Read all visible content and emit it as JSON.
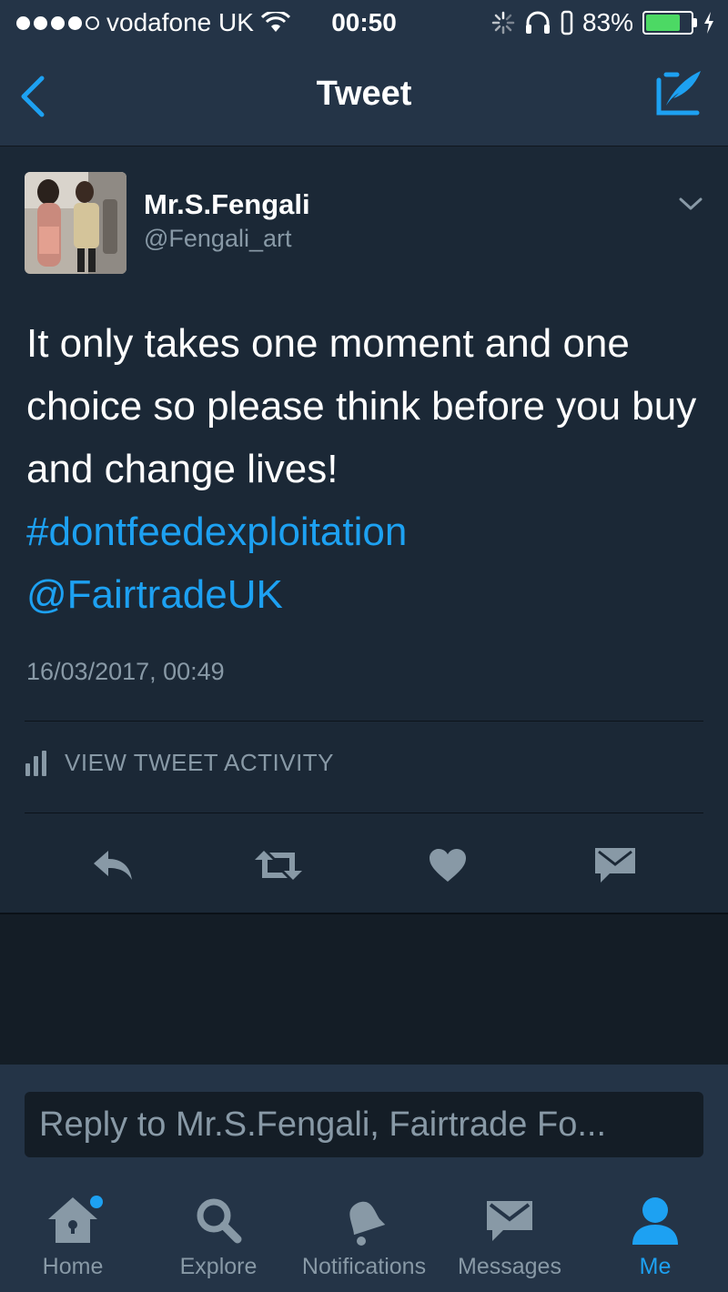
{
  "status_bar": {
    "carrier": "vodafone UK",
    "time": "00:50",
    "battery_percent": "83%",
    "battery_level": 0.83,
    "signal_bars_filled": 4,
    "signal_bars_total": 5
  },
  "nav": {
    "title": "Tweet",
    "back_icon": "chevron-left-icon",
    "compose_icon": "compose-tweet-icon"
  },
  "tweet": {
    "display_name": "Mr.S.Fengali",
    "handle": "@Fengali_art",
    "text_plain": "It only takes one moment and one choice so please think before you buy  and change lives!",
    "hashtag": "#dontfeedexploitation",
    "mention": "@FairtradeUK",
    "timestamp": "16/03/2017, 00:49",
    "activity_label": "VIEW TWEET ACTIVITY"
  },
  "actions": [
    "reply-icon",
    "retweet-icon",
    "like-icon",
    "direct-message-icon"
  ],
  "reply": {
    "placeholder": "Reply to Mr.S.Fengali, Fairtrade Fo..."
  },
  "tabs": [
    {
      "label": "Home",
      "icon": "home-icon",
      "badge": true
    },
    {
      "label": "Explore",
      "icon": "search-icon"
    },
    {
      "label": "Notifications",
      "icon": "bell-icon"
    },
    {
      "label": "Messages",
      "icon": "envelope-icon"
    },
    {
      "label": "Me",
      "icon": "person-icon",
      "active": true
    }
  ],
  "colors": {
    "accent": "#1da1f2",
    "background": "#141d26",
    "card": "#1b2836",
    "bar": "#243447",
    "muted": "#8899a6",
    "battery": "#4cd964"
  }
}
